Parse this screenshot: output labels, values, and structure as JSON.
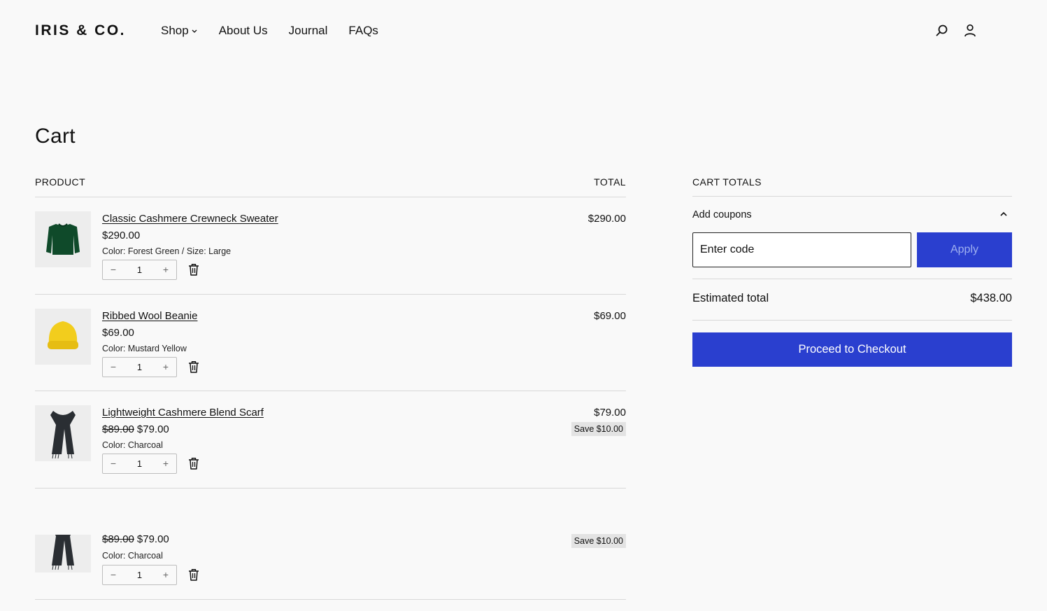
{
  "header": {
    "logo": "IRIS & CO.",
    "nav": [
      {
        "label": "Shop",
        "has_dropdown": true
      },
      {
        "label": "About Us"
      },
      {
        "label": "Journal"
      },
      {
        "label": "FAQs"
      }
    ],
    "icons": [
      "search-icon",
      "account-icon"
    ]
  },
  "page": {
    "title": "Cart",
    "columns": {
      "product": "PRODUCT",
      "total": "TOTAL"
    }
  },
  "items": [
    {
      "title": "Classic Cashmere Crewneck Sweater",
      "price": "$290.00",
      "old_price": "",
      "variant": "Color: Forest Green / Size: Large",
      "qty": "1",
      "line_total": "$290.00",
      "save": "",
      "image": "green-sweater"
    },
    {
      "title": "Ribbed Wool Beanie",
      "price": "$69.00",
      "old_price": "",
      "variant": "Color: Mustard Yellow",
      "qty": "1",
      "line_total": "$69.00",
      "save": "",
      "image": "yellow-beanie"
    },
    {
      "title": "Lightweight Cashmere Blend Scarf",
      "price": "$79.00",
      "old_price": "$89.00",
      "variant": "Color: Charcoal",
      "qty": "1",
      "line_total": "$79.00",
      "save": "Save $10.00",
      "image": "charcoal-scarf"
    },
    {
      "title": "",
      "price": "$79.00",
      "old_price": "$89.00",
      "variant": "Color: Charcoal",
      "qty": "1",
      "line_total": "",
      "save": "Save $10.00",
      "image": "charcoal-scarf"
    }
  ],
  "qty_controls": {
    "minus": "−",
    "plus": "+"
  },
  "totals": {
    "heading": "CART TOTALS",
    "coupon_toggle": "Add coupons",
    "coupon_placeholder": "Enter code",
    "apply": "Apply",
    "estimated_label": "Estimated total",
    "estimated_value": "$438.00",
    "checkout": "Proceed to Checkout"
  },
  "colors": {
    "accent": "#2a3fcf",
    "background": "#f9f9f9"
  }
}
